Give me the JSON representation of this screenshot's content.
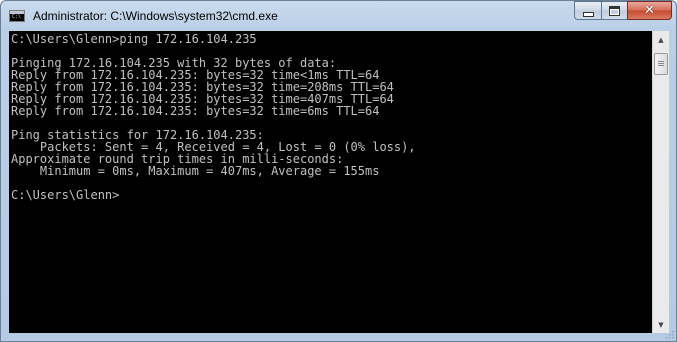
{
  "window": {
    "title": "Administrator: C:\\Windows\\system32\\cmd.exe",
    "icon": "cmd-app-icon",
    "buttons": {
      "minimize": "minimize-icon",
      "maximize": "maximize-icon",
      "close": "close-icon"
    }
  },
  "console": {
    "background": "#000000",
    "foreground": "#c0c0c0",
    "lines": [
      "C:\\Users\\Glenn>ping 172.16.104.235",
      "",
      "Pinging 172.16.104.235 with 32 bytes of data:",
      "Reply from 172.16.104.235: bytes=32 time<1ms TTL=64",
      "Reply from 172.16.104.235: bytes=32 time=208ms TTL=64",
      "Reply from 172.16.104.235: bytes=32 time=407ms TTL=64",
      "Reply from 172.16.104.235: bytes=32 time=6ms TTL=64",
      "",
      "Ping statistics for 172.16.104.235:",
      "    Packets: Sent = 4, Received = 4, Lost = 0 (0% loss),",
      "Approximate round trip times in milli-seconds:",
      "    Minimum = 0ms, Maximum = 407ms, Average = 155ms",
      "",
      "C:\\Users\\Glenn>"
    ]
  },
  "scrollbar": {
    "up": "scroll-up-arrow-icon",
    "down": "scroll-down-arrow-icon",
    "position": 0.0
  }
}
